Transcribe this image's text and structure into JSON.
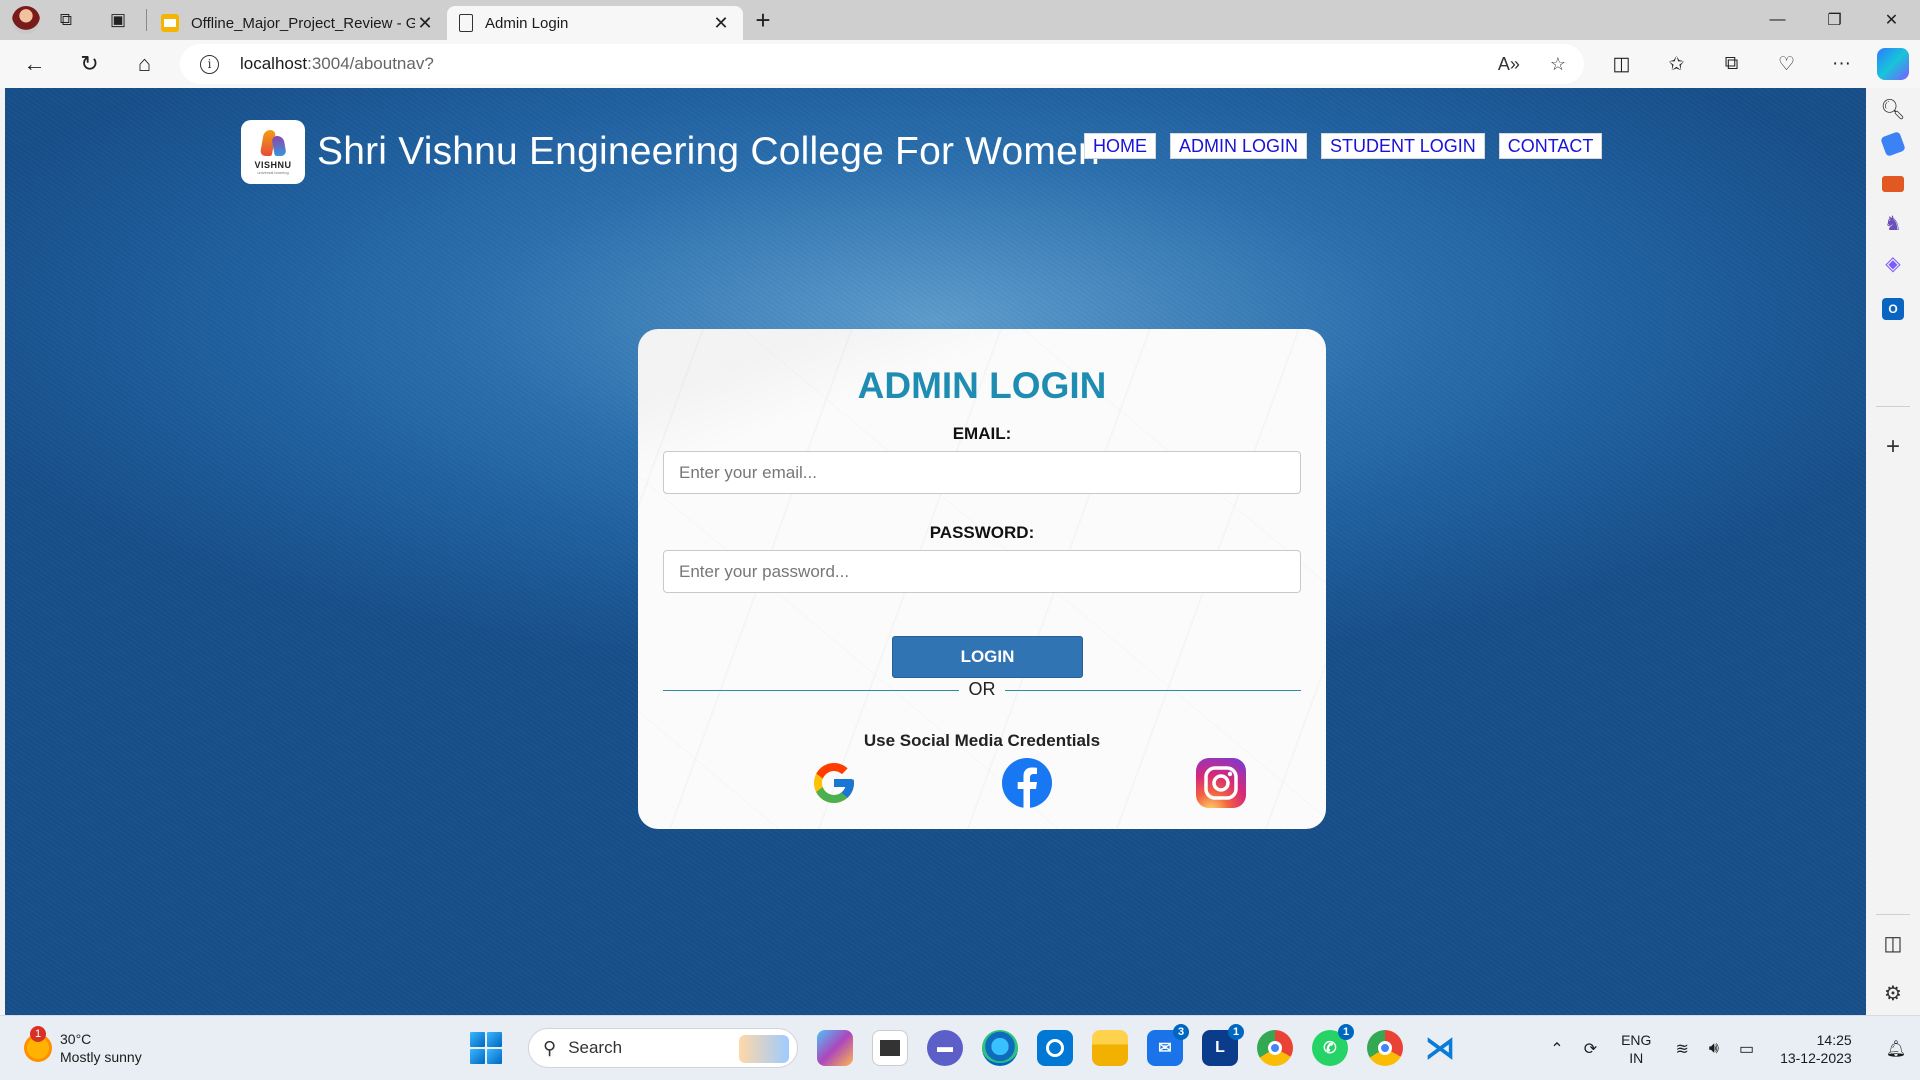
{
  "browser": {
    "tabs": [
      {
        "title": "Offline_Major_Project_Review - G",
        "active": false,
        "icon": "slides-icon"
      },
      {
        "title": "Admin Login",
        "active": true,
        "icon": "page-icon"
      }
    ],
    "address": {
      "host": "localhost",
      "path": ":3004/aboutnav?"
    }
  },
  "site": {
    "logo_text": "VISHNU",
    "logo_subtext": "universal learning",
    "title": "Shri Vishnu Engineering College For Women",
    "nav": [
      "HOME",
      "ADMIN LOGIN",
      "STUDENT LOGIN",
      "CONTACT"
    ]
  },
  "login": {
    "heading": "ADMIN LOGIN",
    "email_label": "EMAIL:",
    "email_placeholder": "Enter your email...",
    "password_label": "PASSWORD:",
    "password_placeholder": "Enter your password...",
    "button": "LOGIN",
    "divider": "OR",
    "social_title": "Use Social Media Credentials",
    "social": [
      "google-icon",
      "facebook-icon",
      "instagram-icon"
    ]
  },
  "colors": {
    "heading": "#1f8db2",
    "button": "#3174b4",
    "nav_link": "#1a12d8",
    "background": "#2b6fae"
  },
  "taskbar": {
    "weather_badge": "1",
    "temperature": "30°C",
    "condition": "Mostly sunny",
    "search": "Search",
    "badges": {
      "mail": "3",
      "l_app": "1",
      "whatsapp": "1"
    },
    "language": "ENG",
    "region": "IN",
    "time": "14:25",
    "date": "13-12-2023"
  }
}
